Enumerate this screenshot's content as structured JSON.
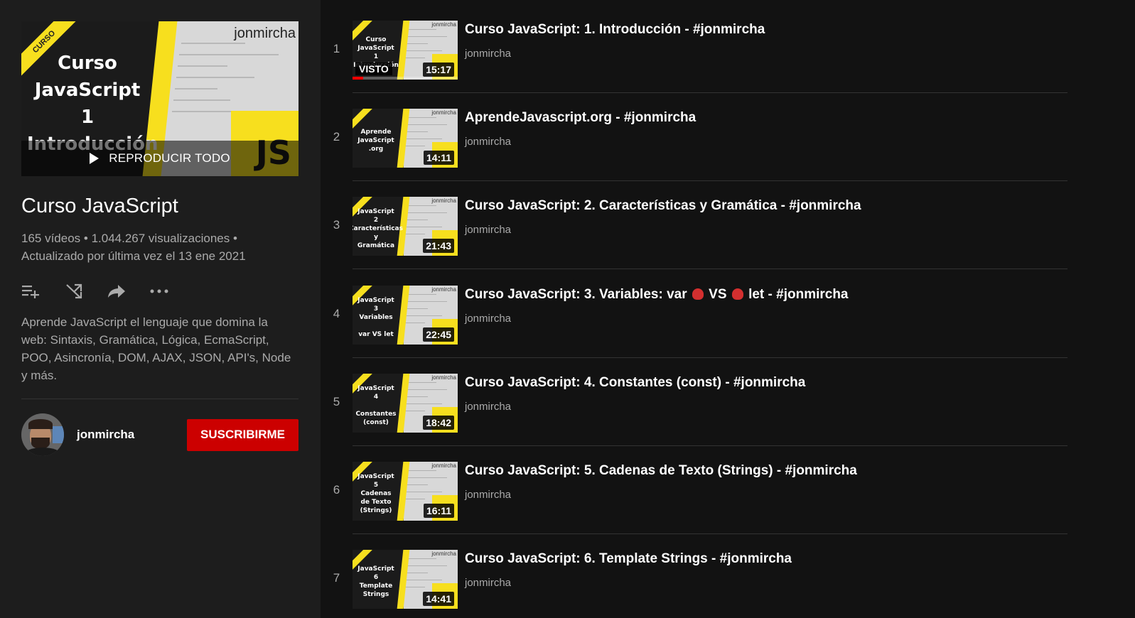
{
  "playlist": {
    "hero_lines": [
      "Curso",
      "JavaScript",
      "1",
      "Introducción"
    ],
    "hero_ribbon": "CURSO",
    "hero_brand": "jonmircha",
    "hero_js": "JS",
    "play_all_label": "REPRODUCIR TODO",
    "title": "Curso JavaScript",
    "stats": "165 vídeos • 1.044.267 visualizaciones • Actualizado por última vez el 13 ene 2021",
    "description": "Aprende JavaScript el lenguaje que domina la web: Sintaxis, Gramática, Lógica, EcmaScript, POO, Asincronía, DOM, AJAX, JSON, API's, Node y más."
  },
  "actions": [
    "add-to-queue-icon",
    "shuffle-icon",
    "share-icon",
    "more-icon"
  ],
  "owner": {
    "name": "jonmircha",
    "subscribe_label": "SUSCRIBIRME"
  },
  "videos": [
    {
      "index": "1",
      "title": "Curso JavaScript: 1. Introducción - #jonmircha",
      "channel": "jonmircha",
      "duration": "15:17",
      "thumb_text": "Curso\nJavaScript\n1\nIntroducción",
      "watched": "VISTO",
      "progress": 0.1
    },
    {
      "index": "2",
      "title": "AprendeJavascript.org - #jonmircha",
      "channel": "jonmircha",
      "duration": "14:11",
      "thumb_text": "Aprende\nJavaScript\n.org"
    },
    {
      "index": "3",
      "title": "Curso JavaScript: 2. Características y Gramática - #jonmircha",
      "channel": "jonmircha",
      "duration": "21:43",
      "thumb_text": "JavaScript\n2\nCaracterísticas\ny\nGramática"
    },
    {
      "index": "4",
      "title_parts": [
        "Curso JavaScript: 3. Variables: var ",
        " VS ",
        " let - #jonmircha"
      ],
      "title": "Curso JavaScript: 3. Variables: var 🥊VS🥊 let - #jonmircha",
      "channel": "jonmircha",
      "duration": "22:45",
      "thumb_text": "JavaScript\n3\nVariables\n\nvar VS let"
    },
    {
      "index": "5",
      "title": "Curso JavaScript: 4. Constantes (const) - #jonmircha",
      "channel": "jonmircha",
      "duration": "18:42",
      "thumb_text": "JavaScript\n4\n\nConstantes\n(const)"
    },
    {
      "index": "6",
      "title": "Curso JavaScript: 5. Cadenas de Texto (Strings) - #jonmircha",
      "channel": "jonmircha",
      "duration": "16:11",
      "thumb_text": "JavaScript\n5\nCadenas\nde Texto\n(Strings)"
    },
    {
      "index": "7",
      "title": "Curso JavaScript: 6. Template Strings - #jonmircha",
      "channel": "jonmircha",
      "duration": "14:41",
      "thumb_text": "JavaScript\n6\nTemplate\nStrings"
    }
  ],
  "colors": {
    "page_bg": "#121212",
    "sidebar_bg": "#1d1d1d",
    "js_yellow": "#f7df1e",
    "subscribe_red": "#cc0000",
    "secondary_text": "#aaaaaa"
  }
}
